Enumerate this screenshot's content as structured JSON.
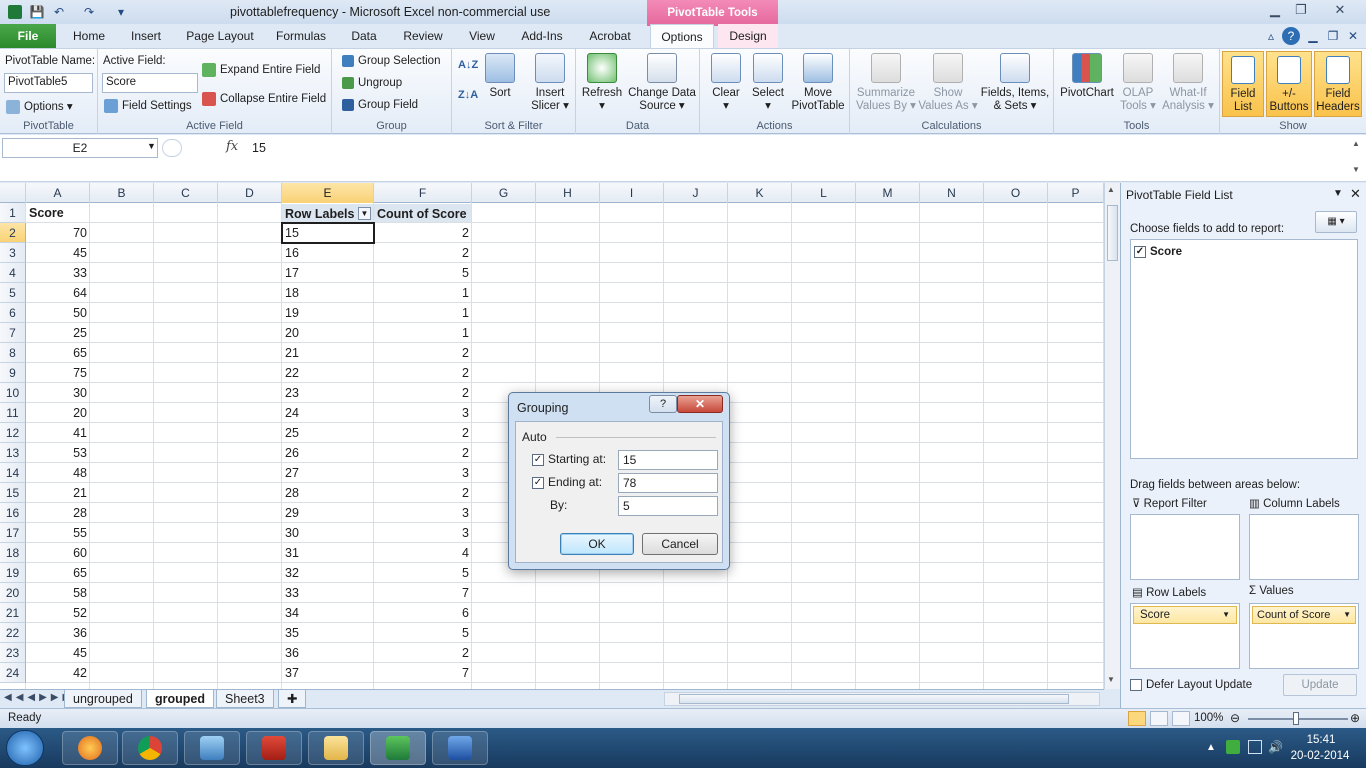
{
  "window": {
    "title": "pivottablefrequency  -  Microsoft Excel non-commercial use",
    "context_tab": "PivotTable Tools"
  },
  "tabs": [
    "File",
    "Home",
    "Insert",
    "Page Layout",
    "Formulas",
    "Data",
    "Review",
    "View",
    "Add-Ins",
    "Acrobat",
    "Options",
    "Design"
  ],
  "ribbon": {
    "pivottable": {
      "name_label": "PivotTable Name:",
      "name_value": "PivotTable5",
      "options_label": "Options",
      "group_label": "PivotTable"
    },
    "active_field": {
      "label": "Active Field:",
      "value": "Score",
      "settings_label": "Field Settings",
      "expand_label": "Expand Entire Field",
      "collapse_label": "Collapse Entire Field",
      "group_label": "Active Field"
    },
    "group": {
      "selection_label": "Group Selection",
      "ungroup_label": "Ungroup",
      "field_label": "Group Field",
      "group_label": "Group"
    },
    "sort": {
      "sort_label": "Sort",
      "slicer_label_1": "Insert",
      "slicer_label_2": "Slicer",
      "group_label": "Sort & Filter"
    },
    "data": {
      "refresh_label": "Refresh",
      "change_1": "Change Data",
      "change_2": "Source",
      "group_label": "Data"
    },
    "actions": {
      "clear_label": "Clear",
      "select_label": "Select",
      "move_1": "Move",
      "move_2": "PivotTable",
      "group_label": "Actions"
    },
    "calculations": {
      "summarize_1": "Summarize",
      "summarize_2": "Values By",
      "show_1": "Show",
      "show_2": "Values As",
      "fields_1": "Fields, Items,",
      "fields_2": "& Sets",
      "group_label": "Calculations"
    },
    "tools": {
      "chart_label": "PivotChart",
      "olap_1": "OLAP",
      "olap_2": "Tools",
      "whatif_1": "What-If",
      "whatif_2": "Analysis",
      "group_label": "Tools"
    },
    "show": {
      "fieldlist_1": "Field",
      "fieldlist_2": "List",
      "buttons_1": "+/-",
      "buttons_2": "Buttons",
      "headers_1": "Field",
      "headers_2": "Headers",
      "group_label": "Show"
    }
  },
  "formula_bar": {
    "name_box": "E2",
    "fx": "fx",
    "value": "15"
  },
  "grid": {
    "columns": [
      "A",
      "B",
      "C",
      "D",
      "E",
      "F",
      "G",
      "H",
      "I",
      "J",
      "K",
      "L",
      "M",
      "N",
      "O",
      "P"
    ],
    "header_row": {
      "a": "Score",
      "e": "Row Labels",
      "f": "Count of Score"
    },
    "rows": [
      {
        "n": "2",
        "score": "70",
        "label": "15",
        "count": "2"
      },
      {
        "n": "3",
        "score": "45",
        "label": "16",
        "count": "2"
      },
      {
        "n": "4",
        "score": "33",
        "label": "17",
        "count": "5"
      },
      {
        "n": "5",
        "score": "64",
        "label": "18",
        "count": "1"
      },
      {
        "n": "6",
        "score": "50",
        "label": "19",
        "count": "1"
      },
      {
        "n": "7",
        "score": "25",
        "label": "20",
        "count": "1"
      },
      {
        "n": "8",
        "score": "65",
        "label": "21",
        "count": "2"
      },
      {
        "n": "9",
        "score": "75",
        "label": "22",
        "count": "2"
      },
      {
        "n": "10",
        "score": "30",
        "label": "23",
        "count": "2"
      },
      {
        "n": "11",
        "score": "20",
        "label": "24",
        "count": "3"
      },
      {
        "n": "12",
        "score": "41",
        "label": "25",
        "count": "2"
      },
      {
        "n": "13",
        "score": "53",
        "label": "26",
        "count": "2"
      },
      {
        "n": "14",
        "score": "48",
        "label": "27",
        "count": "3"
      },
      {
        "n": "15",
        "score": "21",
        "label": "28",
        "count": "2"
      },
      {
        "n": "16",
        "score": "28",
        "label": "29",
        "count": "3"
      },
      {
        "n": "17",
        "score": "55",
        "label": "30",
        "count": "3"
      },
      {
        "n": "18",
        "score": "60",
        "label": "31",
        "count": "4"
      },
      {
        "n": "19",
        "score": "65",
        "label": "32",
        "count": "5"
      },
      {
        "n": "20",
        "score": "58",
        "label": "33",
        "count": "7"
      },
      {
        "n": "21",
        "score": "52",
        "label": "34",
        "count": "6"
      },
      {
        "n": "22",
        "score": "36",
        "label": "35",
        "count": "5"
      },
      {
        "n": "23",
        "score": "45",
        "label": "36",
        "count": "2"
      },
      {
        "n": "24",
        "score": "42",
        "label": "37",
        "count": "7"
      }
    ]
  },
  "sheet_tabs": [
    "ungrouped",
    "grouped",
    "Sheet3"
  ],
  "active_sheet": "grouped",
  "field_list": {
    "title": "PivotTable Field List",
    "choose_label": "Choose fields to add to report:",
    "field_name": "Score",
    "drag_label": "Drag fields between areas below:",
    "report_filter": "Report Filter",
    "column_labels": "Column Labels",
    "row_labels": "Row Labels",
    "values": "Values",
    "row_field": "Score",
    "value_field": "Count of Score",
    "defer_label": "Defer Layout Update",
    "update_label": "Update"
  },
  "dialog": {
    "title": "Grouping",
    "help": "?",
    "section": "Auto",
    "starting_label": "Starting at:",
    "starting_value": "15",
    "ending_label": "Ending at:",
    "ending_value": "78",
    "by_label": "By:",
    "by_value": "5",
    "ok_label": "OK",
    "cancel_label": "Cancel"
  },
  "status": {
    "ready": "Ready",
    "zoom": "100%"
  },
  "taskbar": {
    "time": "15:41",
    "date": "20-02-2014"
  },
  "colors": {
    "file_tab": "#2c8a2c",
    "pivot_tools": "#e5679c",
    "show_highlight": "#f9c24b",
    "close_button": "#c7483a"
  }
}
